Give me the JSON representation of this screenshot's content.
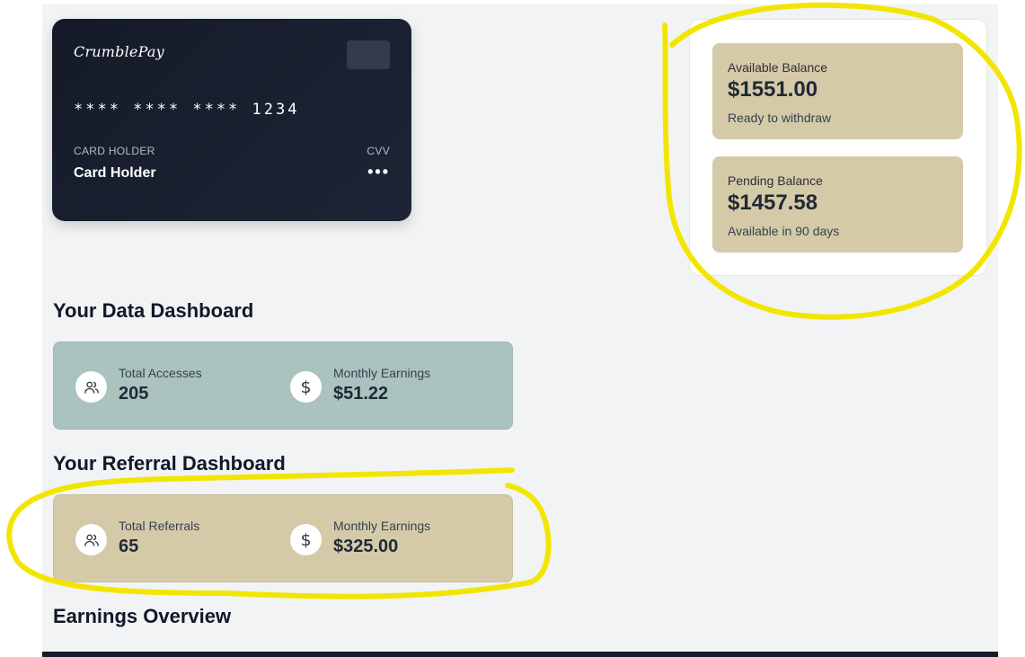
{
  "card": {
    "brand": "CrumblePay",
    "number": "**** **** **** 1234",
    "holder_label": "CARD HOLDER",
    "holder_name": "Card Holder",
    "cvv_label": "CVV",
    "cvv_value": "•••"
  },
  "balances": [
    {
      "title": "Available Balance",
      "amount": "$1551.00",
      "sub": "Ready to withdraw"
    },
    {
      "title": "Pending Balance",
      "amount": "$1457.58",
      "sub": "Available in 90 days"
    }
  ],
  "data_dashboard": {
    "title": "Your Data Dashboard",
    "stats": [
      {
        "label": "Total Accesses",
        "value": "205",
        "icon": "users-icon"
      },
      {
        "label": "Monthly Earnings",
        "value": "$51.22",
        "icon": "dollar-icon"
      }
    ]
  },
  "referral_dashboard": {
    "title": "Your Referral Dashboard",
    "stats": [
      {
        "label": "Total Referrals",
        "value": "65",
        "icon": "users-icon"
      },
      {
        "label": "Monthly Earnings",
        "value": "$325.00",
        "icon": "dollar-icon"
      }
    ]
  },
  "earnings": {
    "title": "Earnings Overview"
  },
  "colors": {
    "page_bg": "#f1f3f5",
    "card_bg": "#141a27",
    "balance_box": "#d5caa8",
    "data_panel": "#abc3bf",
    "referral_panel": "#d5caa8",
    "annotation": "#f2e600"
  }
}
